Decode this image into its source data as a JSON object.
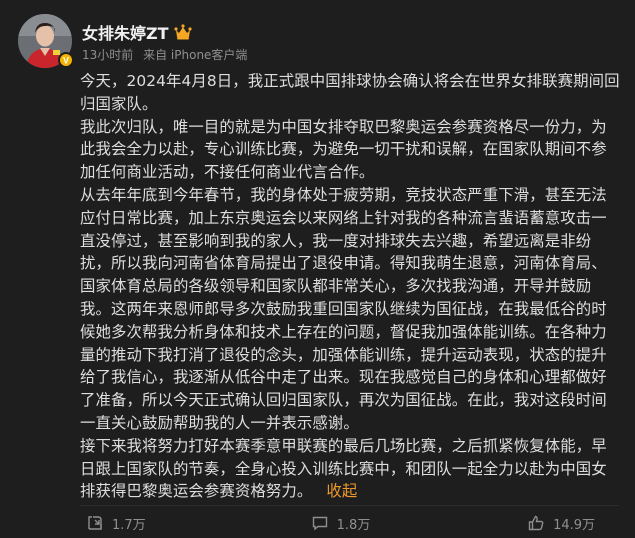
{
  "user": {
    "name": "女排朱婷ZT",
    "avatar_icon": "avatar-photo",
    "badge_icon": "verified-badge-icon",
    "member_icon": "crown-member-icon"
  },
  "meta": {
    "time": "13小时前",
    "source": "来自 iPhone客户端"
  },
  "content": {
    "paragraphs": [
      "今天，2024年4月8日，我正式跟中国排球协会确认将会在世界女排联赛期间回归国家队。",
      "我此次归队，唯一目的就是为中国女排夺取巴黎奥运会参赛资格尽一份力，为此我会全力以赴，专心训练比赛，为避免一切干扰和误解，在国家队期间不参加任何商业活动，不接任何商业代言合作。",
      "从去年年底到今年春节，我的身体处于疲劳期，竞技状态严重下滑，甚至无法应付日常比赛，加上东京奥运会以来网络上针对我的各种流言蜚语蓄意攻击一直没停过，甚至影响到我的家人，我一度对排球失去兴趣，希望远离是非纷扰，所以我向河南省体育局提出了退役申请。得知我萌生退意，河南体育局、国家体育总局的各级领导和国家队都非常关心，多次找我沟通，开导并鼓励我。这两年来恩师郎导多次鼓励我重回国家队继续为国征战，在我最低谷的时候她多次帮我分析身体和技术上存在的问题，督促我加强体能训练。在各种力量的推动下我打消了退役的念头，加强体能训练，提升运动表现，状态的提升给了我信心，我逐渐从低谷中走了出来。现在我感觉自己的身体和心理都做好了准备，所以今天正式确认回归国家队，再次为国征战。在此，我对这段时间一直关心鼓励帮助我的人一并表示感谢。",
      "接下来我将努力打好本赛季意甲联赛的最后几场比赛，之后抓紧恢复体能，早日跟上国家队的节奏，全身心投入训练比赛中，和团队一起全力以赴为中国女排获得巴黎奥运会参赛资格努力。"
    ],
    "collapse_label": "收起"
  },
  "actions": {
    "repost": {
      "icon": "repost-icon",
      "count": "1.7万"
    },
    "comment": {
      "icon": "comment-icon",
      "count": "1.8万"
    },
    "like": {
      "icon": "like-icon",
      "count": "14.9万"
    }
  },
  "colors": {
    "background": "#1e1e1e",
    "text": "#dedede",
    "muted": "#8f8f8f",
    "accent": "#f09a2c",
    "badge": "#f5b400"
  }
}
